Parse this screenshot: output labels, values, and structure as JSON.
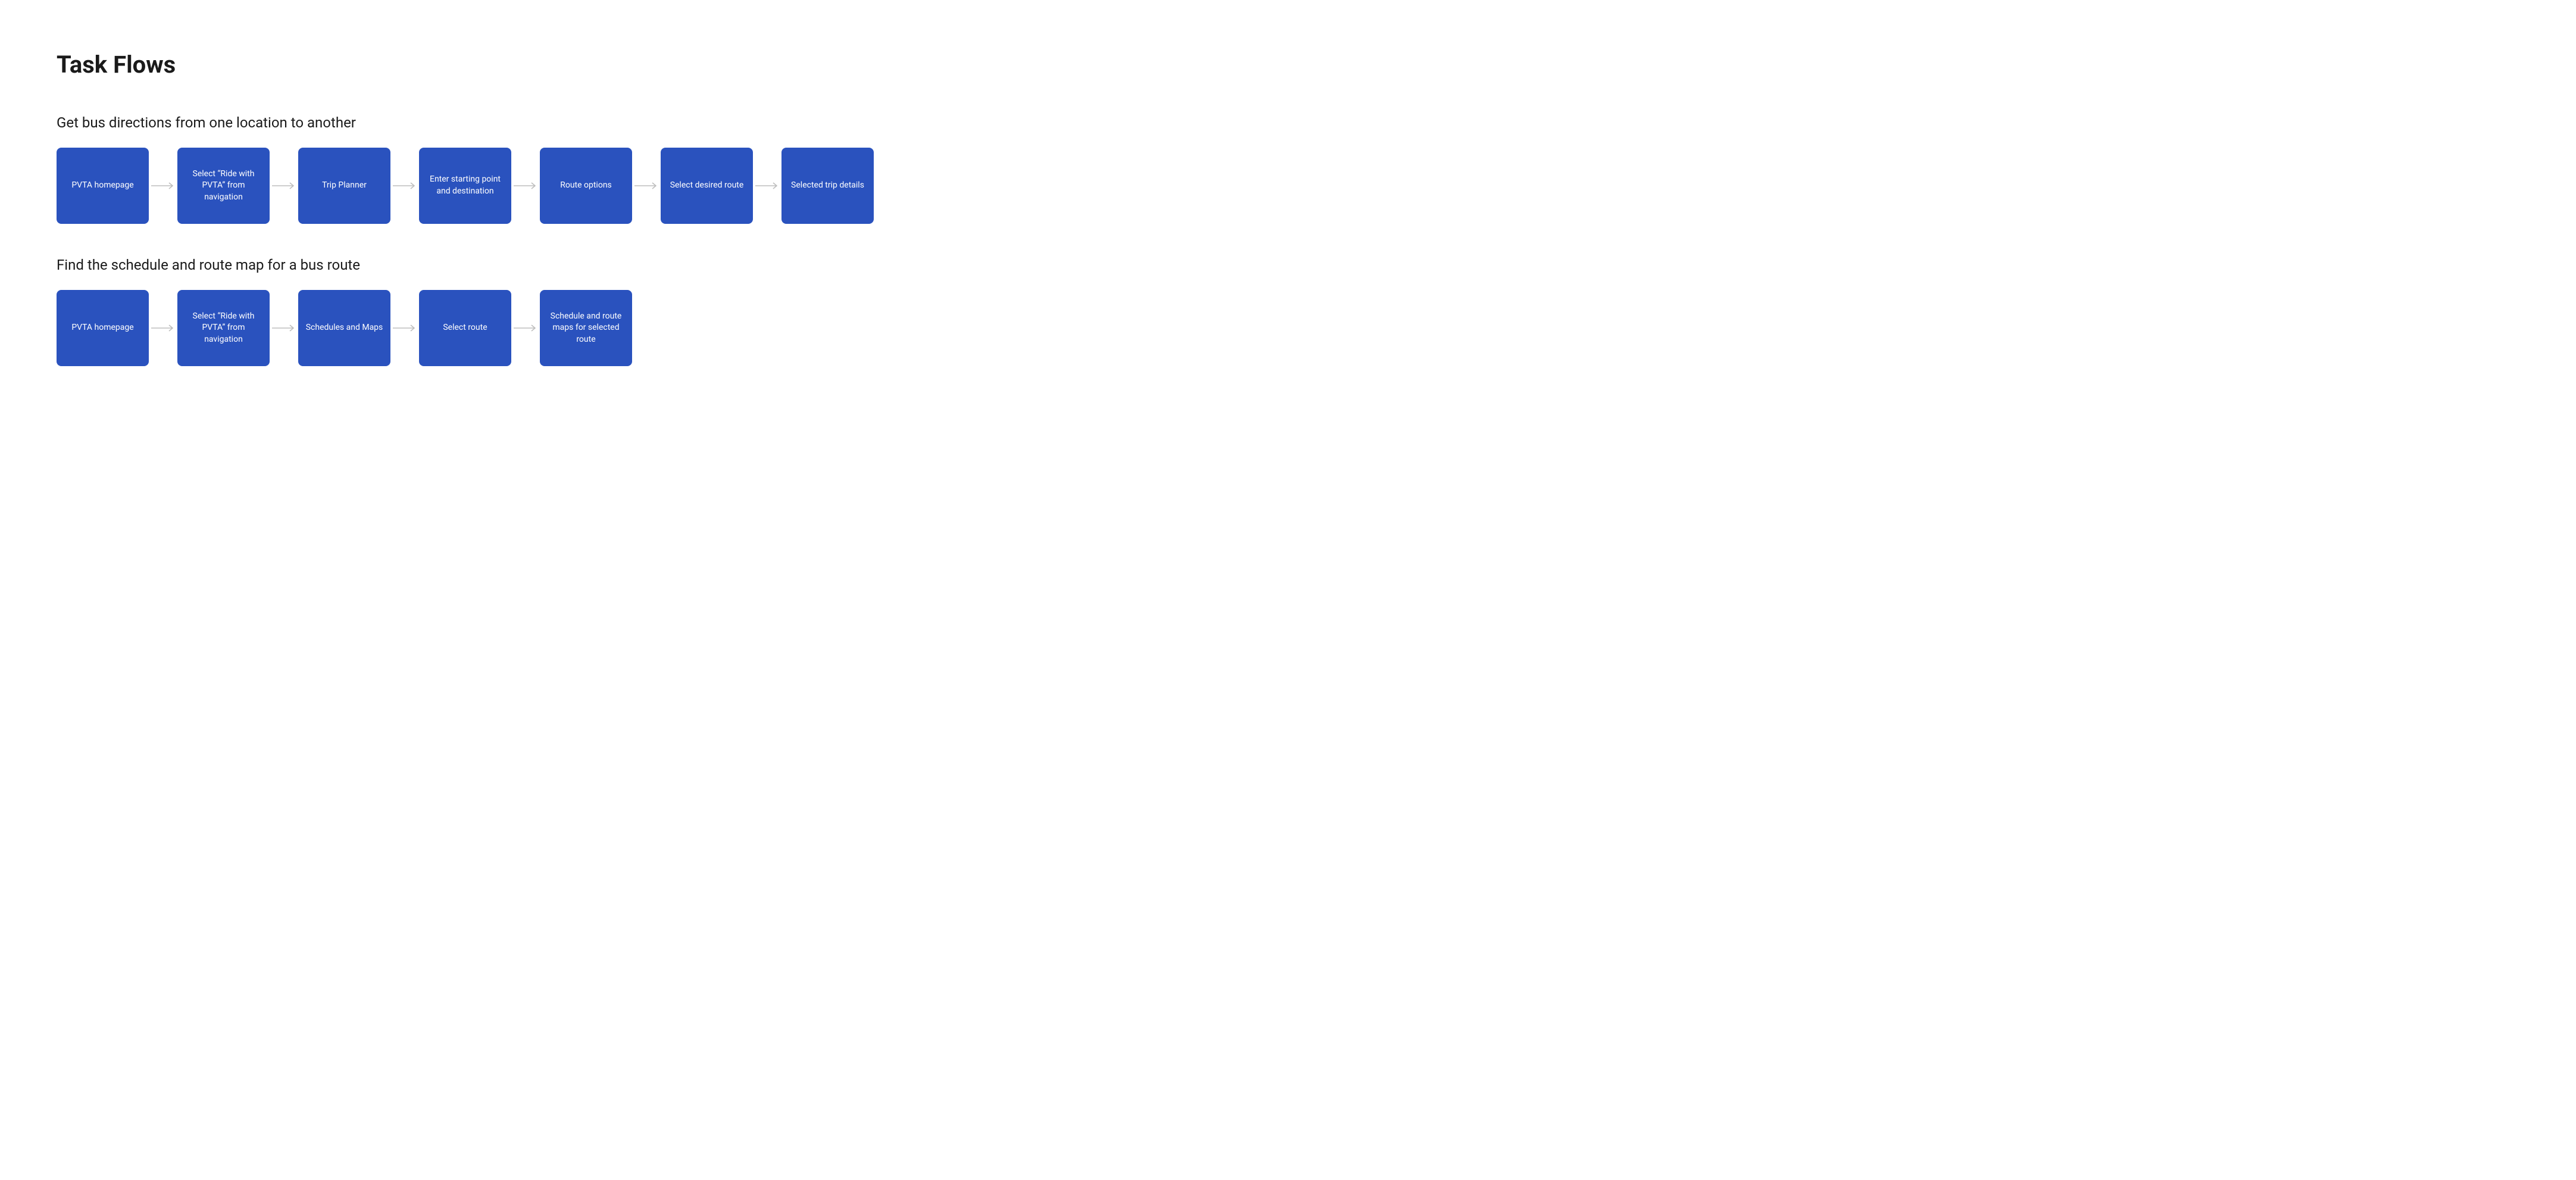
{
  "title": "Task Flows",
  "colors": {
    "stepBg": "#2a52be",
    "stepText": "#ffffff",
    "arrow": "#bdbdbd",
    "heading": "#1a1a1a"
  },
  "flows": [
    {
      "label": "Get bus directions from one location to another",
      "steps": [
        "PVTA homepage",
        "Select “Ride with PVTA” from navigation",
        "Trip Planner",
        "Enter starting point and destination",
        "Route options",
        "Select desired route",
        "Selected trip details"
      ]
    },
    {
      "label": "Find the schedule and route map for a bus route",
      "steps": [
        "PVTA homepage",
        "Select “Ride with PVTA” from navigation",
        "Schedules and Maps",
        "Select route",
        "Schedule and route maps for selected route"
      ]
    }
  ]
}
